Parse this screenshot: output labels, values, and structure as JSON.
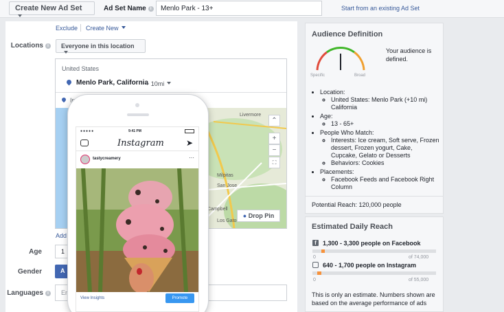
{
  "header": {
    "campaign_button": "Create New Ad Set",
    "adset_label": "Ad Set Name",
    "adset_value": "Menlo Park - 13+",
    "existing_link": "Start from an existing Ad Set"
  },
  "locations": {
    "exclude_link": "Exclude",
    "create_new_link": "Create New",
    "label": "Locations",
    "dropdown": "Everyone in this location",
    "country": "United States",
    "city": "Menlo Park, California",
    "radius": "+ 10mi",
    "include_prefix": "In",
    "add_link": "Add"
  },
  "map": {
    "drop_pin": "Drop Pin",
    "towns": [
      "Livermore",
      "Milpitas",
      "San Jose",
      "Campbell",
      "Los Gatos"
    ],
    "zoom_in": "+",
    "zoom_out": "−"
  },
  "form": {
    "age_label": "Age",
    "age_value": "1",
    "gender_label": "Gender",
    "gender_value": "A",
    "languages_label": "Languages",
    "languages_placeholder": "Ent"
  },
  "phone": {
    "time": "9:41 PM",
    "app_title": "Instagram",
    "username": "tastycreamery",
    "more": "···",
    "view_insights": "View Insights",
    "promote": "Promote"
  },
  "audience": {
    "title": "Audience Definition",
    "gauge_left": "Specific",
    "gauge_right": "Broad",
    "gauge_level": 0.5,
    "status": "Your audience is defined.",
    "items": [
      {
        "label": "Location:",
        "sub": [
          "United States: Menlo Park (+10 mi) California"
        ]
      },
      {
        "label": "Age:",
        "sub": [
          "13 - 65+"
        ]
      },
      {
        "label": "People Who Match:",
        "sub": [
          "Interests: Ice cream, Soft serve, Frozen dessert, Frozen yogurt, Cake, Cupcake, Gelato or Desserts",
          "Behaviors: Cookies"
        ]
      },
      {
        "label": "Placements:",
        "sub": [
          "Facebook Feeds and Facebook Right Column"
        ]
      }
    ],
    "potential_reach": "Potential Reach: 120,000 people"
  },
  "reach": {
    "title": "Estimated Daily Reach",
    "facebook": {
      "text": "1,300 - 3,300 people on Facebook",
      "of": "of 74,000",
      "bar_start": 0.07,
      "bar_end": 0.1
    },
    "instagram": {
      "text": "640 - 1,700 people on Instagram",
      "of": "of 55,000",
      "bar_start": 0.04,
      "bar_end": 0.07
    },
    "note": "This is only an estimate. Numbers shown are based on the average performance of ads"
  },
  "colors": {
    "accent": "#4267b2",
    "link": "#365899",
    "bar": "#f7923b",
    "panel": "#f6f7f9"
  }
}
